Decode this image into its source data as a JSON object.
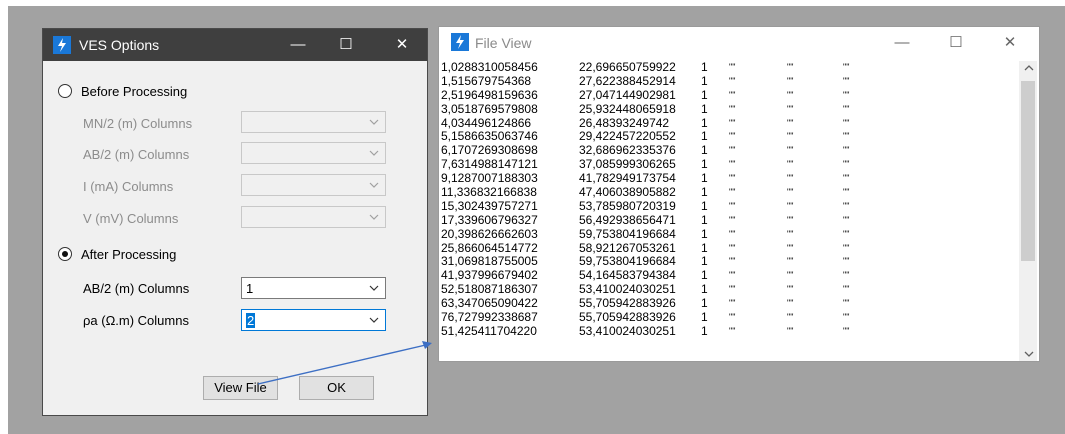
{
  "ves": {
    "title": "VES Options",
    "win_min": "—",
    "win_max": "☐",
    "win_close": "✕",
    "before_label": "Before Processing",
    "before_fields": [
      {
        "label": "MN/2 (m) Columns"
      },
      {
        "label": "AB/2 (m) Columns"
      },
      {
        "label": "I (mA) Columns"
      },
      {
        "label": "V (mV) Columns"
      }
    ],
    "after_label": "After Processing",
    "after_fields": [
      {
        "label": "AB/2 (m) Columns",
        "value": "1"
      },
      {
        "label": "ρa (Ω.m) Columns",
        "value": "2"
      }
    ],
    "view_file_label": "View File",
    "ok_label": "OK",
    "selected_option": "after"
  },
  "fileview": {
    "title": "File View",
    "win_min": "—",
    "win_max": "☐",
    "win_close": "✕",
    "quote": "\"\"",
    "rows": [
      [
        "1,0288310058456",
        "22,696650759922",
        "1"
      ],
      [
        "1,515679754368",
        "27,622388452914",
        "1"
      ],
      [
        "2,5196498159636",
        "27,047144902981",
        "1"
      ],
      [
        "3,0518769579808",
        "25,932448065918",
        "1"
      ],
      [
        "4,034496124866",
        "26,48393249742",
        "1"
      ],
      [
        "5,1586635063746",
        "29,422457220552",
        "1"
      ],
      [
        "6,1707269308698",
        "32,686962335376",
        "1"
      ],
      [
        "7,6314988147121",
        "37,085999306265",
        "1"
      ],
      [
        "9,1287007188303",
        "41,782949173754",
        "1"
      ],
      [
        "11,336832166838",
        "47,406038905882",
        "1"
      ],
      [
        "15,302439757271",
        "53,785980720319",
        "1"
      ],
      [
        "17,339606796327",
        "56,492938656471",
        "1"
      ],
      [
        "20,398626662603",
        "59,753804196684",
        "1"
      ],
      [
        "25,866064514772",
        "58,921267053261",
        "1"
      ],
      [
        "31,069818755005",
        "59,753804196684",
        "1"
      ],
      [
        "41,937996679402",
        "54,164583794384",
        "1"
      ],
      [
        "52,518087186307",
        "53,410024030251",
        "1"
      ],
      [
        "63,347065090422",
        "55,705942883926",
        "1"
      ],
      [
        "76,727992338687",
        "55,705942883926",
        "1"
      ],
      [
        "51,425411704220",
        "53,410024030251",
        "1"
      ]
    ]
  },
  "colors": {
    "accent": "#0078d7",
    "icon_bg": "#1a78d8",
    "arrow": "#3d6fc4"
  }
}
